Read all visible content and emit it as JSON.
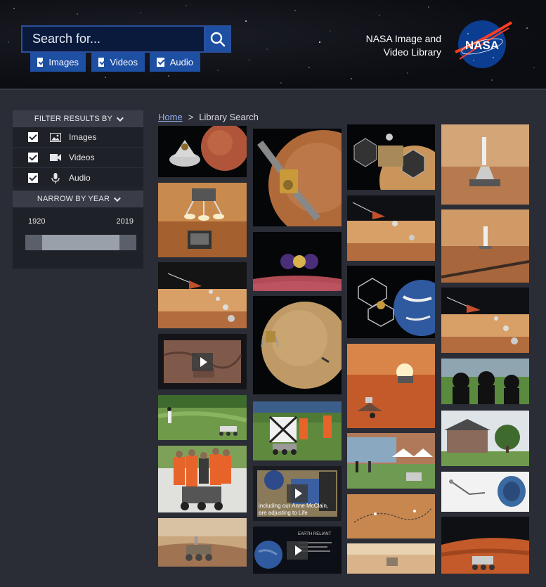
{
  "search": {
    "placeholder": "Search for..."
  },
  "media_types": [
    {
      "label": "Images",
      "checked": true
    },
    {
      "label": "Videos",
      "checked": true
    },
    {
      "label": "Audio",
      "checked": true
    }
  ],
  "brand": {
    "line1": "NASA Image and",
    "line2": "Video Library",
    "logo_text": "NASA"
  },
  "sidebar": {
    "filter_heading": "FILTER RESULTS BY",
    "filters": [
      {
        "label": "Images",
        "icon": "image-icon",
        "checked": true
      },
      {
        "label": "Videos",
        "icon": "video-camera-icon",
        "checked": true
      },
      {
        "label": "Audio",
        "icon": "microphone-icon",
        "checked": true
      }
    ],
    "year_heading": "NARROW BY YEAR",
    "year_start": "1920",
    "year_end": "2019"
  },
  "breadcrumb": {
    "home": "Home",
    "separator": ">",
    "current": "Library Search"
  },
  "tiles": {
    "video_caption_1": "including our Anne McClain, are adjusting to Life",
    "video_caption_2": "EARTH RELIANT"
  },
  "colors": {
    "accent": "#1d4fa3",
    "page_bg": "#2a2c36",
    "nasa_blue": "#0b3d91",
    "nasa_red": "#fc3d21"
  }
}
